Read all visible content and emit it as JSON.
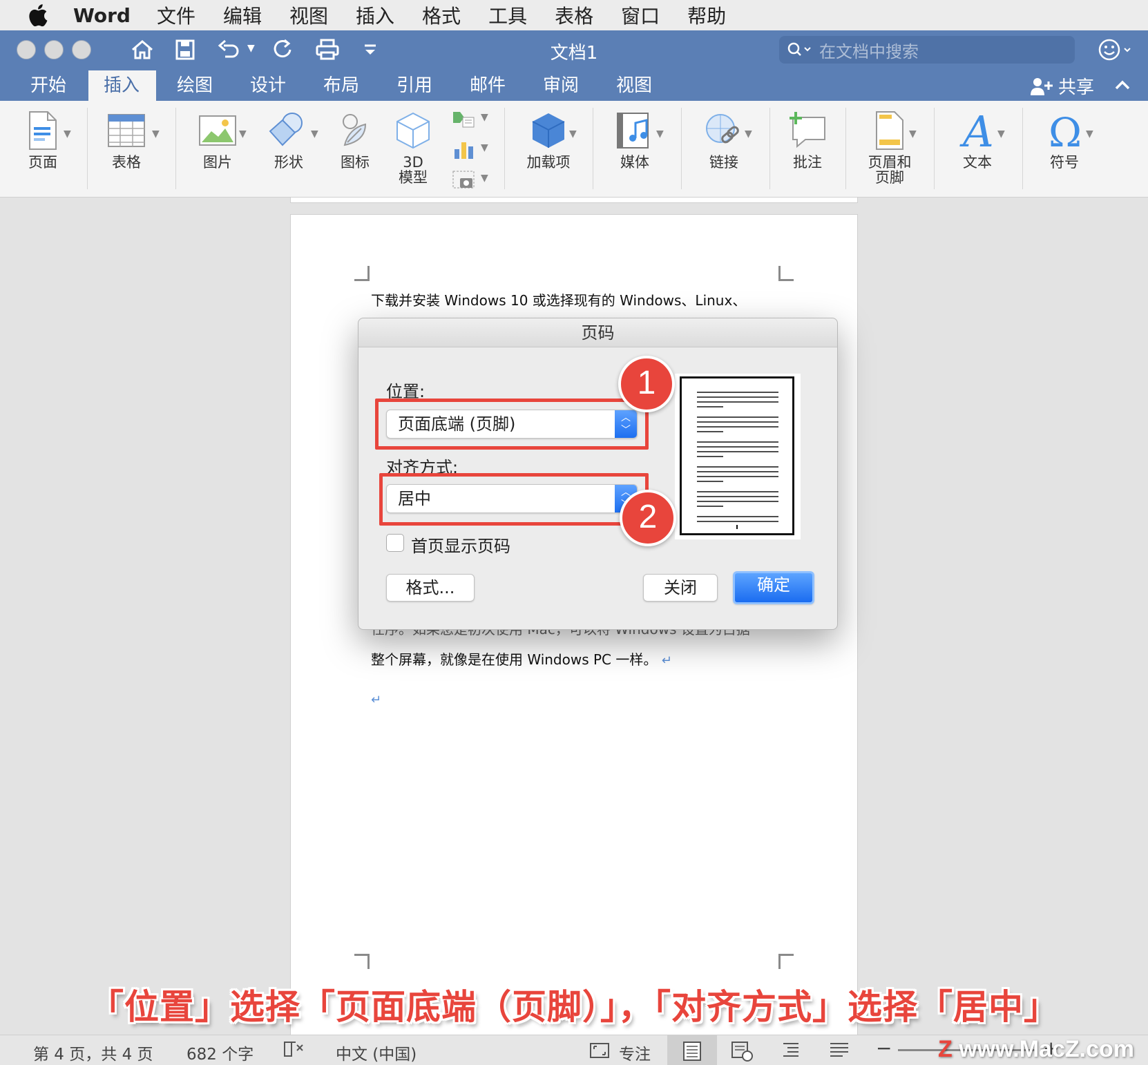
{
  "menubar": {
    "app_name": "Word",
    "items": [
      "文件",
      "编辑",
      "视图",
      "插入",
      "格式",
      "工具",
      "表格",
      "窗口",
      "帮助"
    ]
  },
  "titlebar": {
    "title": "文档1",
    "search_placeholder": "在文档中搜索"
  },
  "tabs": {
    "items": [
      "开始",
      "插入",
      "绘图",
      "设计",
      "布局",
      "引用",
      "邮件",
      "审阅",
      "视图"
    ],
    "active": "插入",
    "share_label": "共享"
  },
  "ribbon": {
    "page": "页面",
    "table": "表格",
    "picture": "图片",
    "shape": "形状",
    "icon": "图标",
    "model_3d_line1": "3D",
    "model_3d_line2": "模型",
    "addins": "加载项",
    "media": "媒体",
    "link": "链接",
    "comment": "批注",
    "header_footer_line1": "页眉和",
    "header_footer_line2": "页脚",
    "text": "文本",
    "symbol": "符号"
  },
  "document": {
    "line1": "下载并安装 Windows 10 或选择现有的 Windows、Linux、",
    "line_partial": "任序。如果您是初次使用 Mac，可以将 Windows 设置为占据",
    "line2": "整个屏幕，就像是在使用 Windows PC 一样。",
    "para_mark": "↵"
  },
  "dialog": {
    "title": "页码",
    "position_label": "位置:",
    "position_value": "页面底端 (页脚)",
    "alignment_label": "对齐方式:",
    "alignment_value": "居中",
    "first_page_label": "首页显示页码",
    "first_page_checked": false,
    "format_button": "格式...",
    "close_button": "关闭",
    "ok_button": "确定",
    "badge1": "1",
    "badge2": "2"
  },
  "caption": "「位置」选择「页面底端（页脚）」，「对齐方式」选择「居中」",
  "statusbar": {
    "page_info": "第 4 页，共 4 页",
    "word_count": "682 个字",
    "language": "中文 (中国)",
    "focus": "专注",
    "zoom_minus": "−",
    "zoom_plus": "+"
  },
  "watermark": {
    "z": "Z",
    "text": "www.MacZ.com"
  },
  "colors": {
    "accent_blue": "#5b7fb5",
    "highlight_red": "#e8453c",
    "primary_button": "#1a6cf0"
  }
}
